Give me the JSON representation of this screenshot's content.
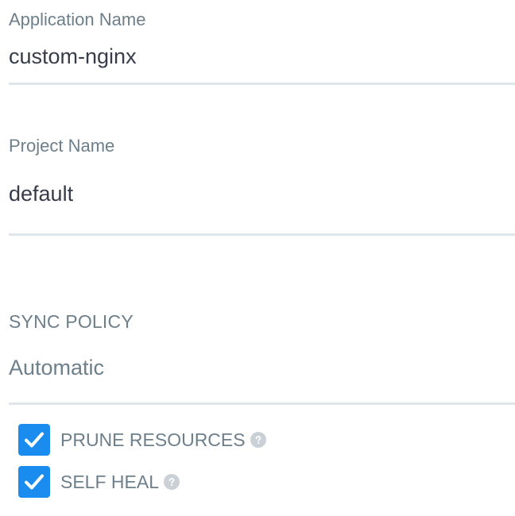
{
  "application": {
    "label": "Application Name",
    "value": "custom-nginx"
  },
  "project": {
    "label": "Project Name",
    "value": "default"
  },
  "sync_policy": {
    "title": "SYNC POLICY",
    "selected": "Automatic",
    "options": [
      {
        "label": "PRUNE RESOURCES",
        "checked": true,
        "icon": "help-icon"
      },
      {
        "label": "SELF HEAL",
        "checked": true,
        "icon": "help-icon"
      }
    ]
  },
  "colors": {
    "accent": "#1a8cf0",
    "label": "#6d7f8b",
    "text": "#363c4a",
    "divider": "#dee6eb",
    "help_icon": "#c9d1d6"
  }
}
